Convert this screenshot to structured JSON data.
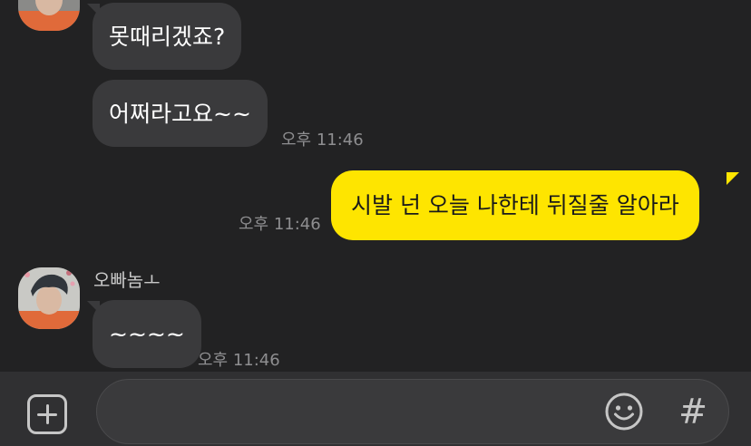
{
  "chat": {
    "sender_name": "오빠놈ㅗ",
    "messages": [
      {
        "direction": "in",
        "text": "못때리겠죠?"
      },
      {
        "direction": "in",
        "text": "어쩌라고요~~",
        "time": "오후 11:46"
      },
      {
        "direction": "out",
        "text": "시발 넌 오늘 나한테 뒤질줄 알아라",
        "time": "오후 11:46"
      },
      {
        "direction": "in",
        "text": "~~~~",
        "time": "오후 11:46"
      }
    ]
  },
  "input_bar": {
    "message_value": "",
    "icons": {
      "add": "plus-square-icon",
      "emoji": "smiley-icon",
      "hashtag": "hashtag-icon"
    },
    "hashtag_glyph": "#"
  },
  "colors": {
    "background": "#222223",
    "incoming_bubble": "#3a3a3c",
    "outgoing_bubble": "#fee500",
    "timestamp": "#8e8e90",
    "input_bar": "#303032"
  }
}
